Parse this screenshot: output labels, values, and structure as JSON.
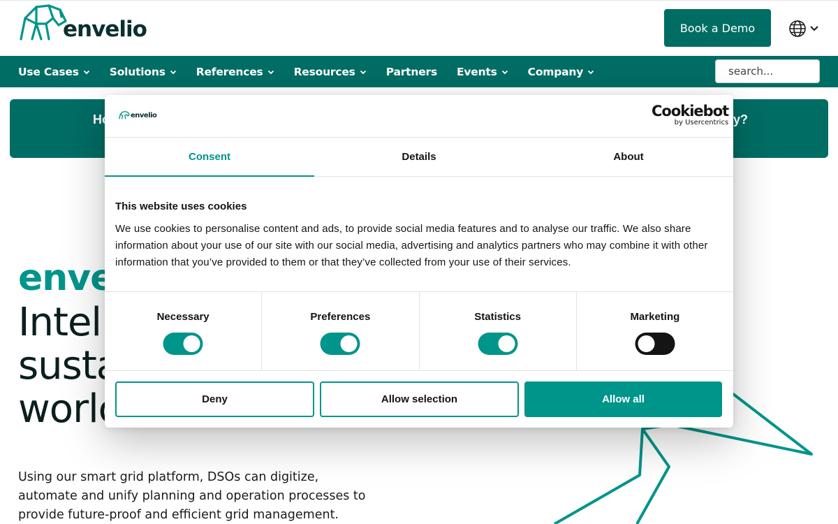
{
  "header": {
    "logo_text": "envelio",
    "demo_button": "Book a Demo",
    "language_icon": "globe-icon"
  },
  "nav": {
    "items": [
      {
        "label": "Use Cases",
        "dropdown": true
      },
      {
        "label": "Solutions",
        "dropdown": true
      },
      {
        "label": "References",
        "dropdown": true
      },
      {
        "label": "Resources",
        "dropdown": true
      },
      {
        "label": "Partners",
        "dropdown": false
      },
      {
        "label": "Events",
        "dropdown": true
      },
      {
        "label": "Company",
        "dropdown": true
      }
    ],
    "search_placeholder": "search..."
  },
  "banner": {
    "text_left": "Ho",
    "text_right": "y?"
  },
  "hero": {
    "brand": "enve",
    "line1": "Intelli",
    "line2": "susta",
    "line3": "worlc",
    "description": "Using our smart grid platform, DSOs can digitize, automate and unify planning and operation processes to provide future-proof and efficient grid management."
  },
  "cookie_dialog": {
    "logo_text": "envelio",
    "provider": "Cookiebot",
    "provider_sub": "by Usercentrics",
    "tabs": [
      {
        "label": "Consent",
        "active": true
      },
      {
        "label": "Details",
        "active": false
      },
      {
        "label": "About",
        "active": false
      }
    ],
    "title": "This website uses cookies",
    "body": "We use cookies to personalise content and ads, to provide social media features and to analyse our traffic. We also share information about your use of our site with our social media, advertising and analytics partners who may combine it with other information that you’ve provided to them or that they’ve collected from your use of their services.",
    "preferences": [
      {
        "label": "Necessary",
        "enabled": true
      },
      {
        "label": "Preferences",
        "enabled": true
      },
      {
        "label": "Statistics",
        "enabled": true
      },
      {
        "label": "Marketing",
        "enabled": false
      }
    ],
    "buttons": {
      "deny": "Deny",
      "allow_selection": "Allow selection",
      "allow_all": "Allow all"
    }
  },
  "colors": {
    "brand_dark": "#006d64",
    "brand_accent": "#00958a",
    "text": "#141414"
  }
}
